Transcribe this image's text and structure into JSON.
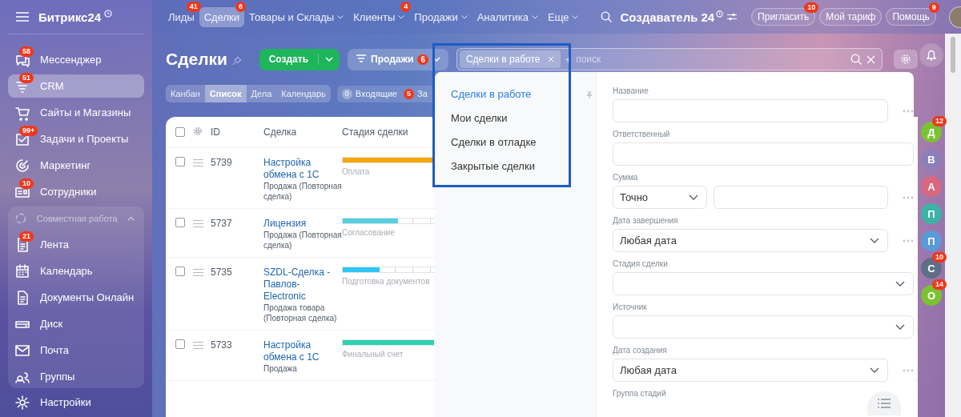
{
  "sidebar": {
    "logo": "Битрикс24",
    "items": [
      {
        "label": "Мессенджер",
        "badge": "58",
        "selected": false
      },
      {
        "label": "CRM",
        "badge": "51",
        "selected": true
      },
      {
        "label": "Сайты и Магазины",
        "selected": false
      },
      {
        "label": "Задачи и Проекты",
        "badge": "99+",
        "selected": false
      },
      {
        "label": "Маркетинг",
        "selected": false
      },
      {
        "label": "Сотрудники",
        "badge": "10",
        "selected": false
      }
    ],
    "group": {
      "label": "Совместная работа",
      "expanded": true,
      "items": [
        {
          "label": "Лента",
          "badge": "21"
        },
        {
          "label": "Календарь"
        },
        {
          "label": "Документы Онлайн"
        },
        {
          "label": "Диск"
        },
        {
          "label": "Почта"
        },
        {
          "label": "Группы"
        }
      ]
    },
    "footer": {
      "label": "Настройки"
    }
  },
  "topnav": {
    "items": [
      {
        "label": "Лиды",
        "badge": "41",
        "dropdown": false,
        "selected": false
      },
      {
        "label": "Сделки",
        "badge": "6",
        "dropdown": false,
        "selected": true
      },
      {
        "label": "Товары и Склады",
        "dropdown": true,
        "selected": false
      },
      {
        "label": "Клиенты",
        "badge": "4",
        "dropdown": true,
        "selected": false
      },
      {
        "label": "Продажи",
        "dropdown": true,
        "selected": false
      },
      {
        "label": "Аналитика",
        "dropdown": true,
        "selected": false
      },
      {
        "label": "Еще",
        "dropdown": true,
        "selected": false
      }
    ],
    "portal": "Создаватель",
    "portal_suffix": "24",
    "buttons": [
      {
        "label": "Пригласить",
        "badge": "10"
      },
      {
        "label": "Мой тариф"
      },
      {
        "label": "Помощь",
        "badge": "9"
      }
    ]
  },
  "page": {
    "title": "Сделки",
    "create": "Создать",
    "category": {
      "label": "Продажи",
      "badge": "6"
    },
    "filter": {
      "chip": "Сделки в работе",
      "add": "+",
      "placeholder": "поиск"
    },
    "views": [
      {
        "label": "Канбан",
        "selected": false
      },
      {
        "label": "Список",
        "selected": true
      },
      {
        "label": "Дела",
        "selected": false
      },
      {
        "label": "Календарь",
        "selected": false
      }
    ],
    "counters": [
      {
        "count": "0",
        "label": "Входящие",
        "alert": false
      },
      {
        "count": "5",
        "label": "За",
        "alert": true
      }
    ]
  },
  "table": {
    "columns": [
      "ID",
      "Сделка",
      "Стадия сделки"
    ],
    "all_checked": false,
    "rows": [
      {
        "checked": false,
        "id": "5739",
        "title": "Настройка обмена с 1С",
        "subtitle": "Продажа (Повторная сделка)",
        "stage": "Оплата",
        "level": 1,
        "color": "#f7a700"
      },
      {
        "checked": false,
        "id": "5737",
        "title": "Лицензия",
        "subtitle": "Продажа (Повторная сделка)",
        "stage": "Согласование",
        "level": 0.43,
        "color": "#55d0e0"
      },
      {
        "checked": false,
        "id": "5735",
        "title": "SZDL-Сделка - Павлов-Electronic",
        "subtitle": "Продажа товара (Повторная сделка)",
        "stage": "Подготовка документов",
        "level": 0.29,
        "color": "#2fc6f6"
      },
      {
        "checked": false,
        "id": "5733",
        "title": "Настройка обмена с 1С",
        "subtitle": "Продажа",
        "stage": "Финальный счет",
        "level": 0.71,
        "color": "#2fd1b1"
      }
    ]
  },
  "filter_popup": {
    "presets": [
      {
        "label": "Сделки в работе",
        "selected": true
      },
      {
        "label": "Мои сделки",
        "selected": false
      },
      {
        "label": "Сделки в отладке",
        "selected": false
      },
      {
        "label": "Закрытые сделки",
        "selected": false
      }
    ],
    "fields": [
      {
        "label": "Название",
        "kind": "text",
        "more": true
      },
      {
        "label": "Ответственный",
        "kind": "text",
        "more": false
      },
      {
        "label": "Сумма",
        "kind": "range",
        "value": "Точно",
        "more": true
      },
      {
        "label": "Дата завершения",
        "kind": "select",
        "value": "Любая дата",
        "more": true
      },
      {
        "label": "Стадия сделки",
        "kind": "select",
        "more": false
      },
      {
        "label": "Источник",
        "kind": "select",
        "more": false
      },
      {
        "label": "Дата создания",
        "kind": "select",
        "value": "Любая дата",
        "more": true
      },
      {
        "label": "Группа стадий",
        "kind": "label",
        "more": false
      }
    ]
  },
  "chats": [
    {
      "letter": "Д",
      "color": "#7bc233",
      "badge": "12"
    },
    {
      "letter": "В",
      "color": "#8a7fb8"
    },
    {
      "letter": "А",
      "color": "#d9687e"
    },
    {
      "letter": "П",
      "color": "#3bb3a5"
    },
    {
      "letter": "П",
      "color": "#5a9ad8"
    },
    {
      "letter": "С",
      "color": "#5f6f86",
      "badge": "10"
    },
    {
      "letter": "О",
      "color": "#7bc233",
      "badge": "14"
    }
  ]
}
